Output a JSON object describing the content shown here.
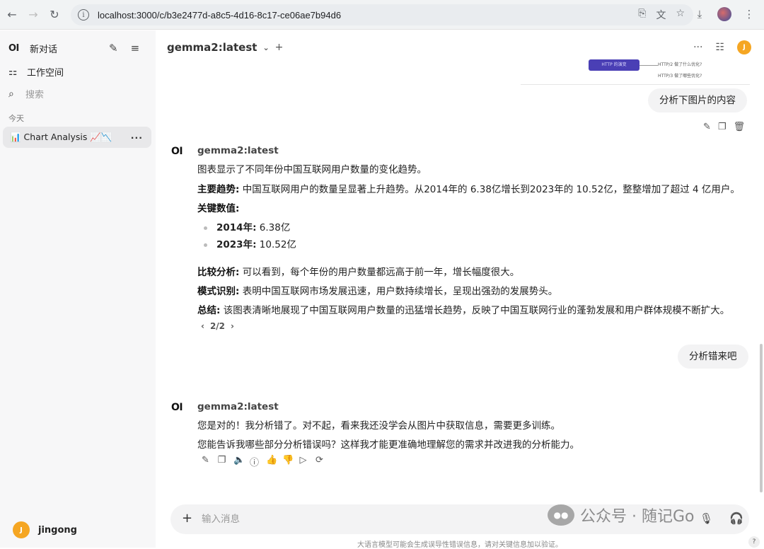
{
  "browser": {
    "url": "localhost:3000/c/b3e2477d-a8c5-4d16-8c17-ce06ae7b94d6"
  },
  "sidebar": {
    "logo": "OI",
    "new_chat": "新对话",
    "workspace": "工作空间",
    "search_placeholder": "搜索",
    "section_today": "今天",
    "chat_item": "📊 Chart Analysis 📈📉",
    "user_name": "jingong",
    "user_initial": "J"
  },
  "header": {
    "model": "gemma2:latest",
    "user_initial": "J"
  },
  "crop_image": {
    "box_label": "HTTP 的演变",
    "label1": "HTTP/2 做了什么优化?",
    "label2": "HTTP/3 做了哪些优化?"
  },
  "messages": {
    "user1": "分析下图片的内容",
    "assistant1": {
      "name": "gemma2:latest",
      "intro": "图表显示了不同年份中国互联网用户数量的变化趋势。",
      "trend_label": "主要趋势:",
      "trend_text": "  中国互联网用户的数量呈显著上升趋势。从2014年的 6.38亿增长到2023年的 10.52亿，整整增加了超过 4 亿用户。",
      "key_label": "关键数值:",
      "b1_label": "2014年:",
      "b1_text": " 6.38亿",
      "b2_label": "2023年:",
      "b2_text": " 10.52亿",
      "compare_label": "比较分析:",
      "compare_text": " 可以看到，每个年份的用户数量都远高于前一年，增长幅度很大。",
      "pattern_label": "模式识别:",
      "pattern_text": " 表明中国互联网市场发展迅速，用户数持续增长，呈现出强劲的发展势头。",
      "summary_label": "总结:",
      "summary_text": " 该图表清晰地展现了中国互联网用户数量的迅猛增长趋势，反映了中国互联网行业的蓬勃发展和用户群体规模不断扩大。",
      "pager": "2/2"
    },
    "user2": "分析错来吧",
    "assistant2": {
      "name": "gemma2:latest",
      "line1": "您是对的！我分析错了。对不起，看来我还没学会从图片中获取信息，需要更多训练。",
      "line2": "您能告诉我哪些部分分析错误吗？这样我才能更准确地理解您的需求并改进我的分析能力。"
    }
  },
  "input": {
    "placeholder": "输入消息"
  },
  "watermark": "公众号 · 随记Go",
  "disclaimer": "大语言模型可能会生成误导性错误信息，请对关键信息加以验证。",
  "help": "?"
}
